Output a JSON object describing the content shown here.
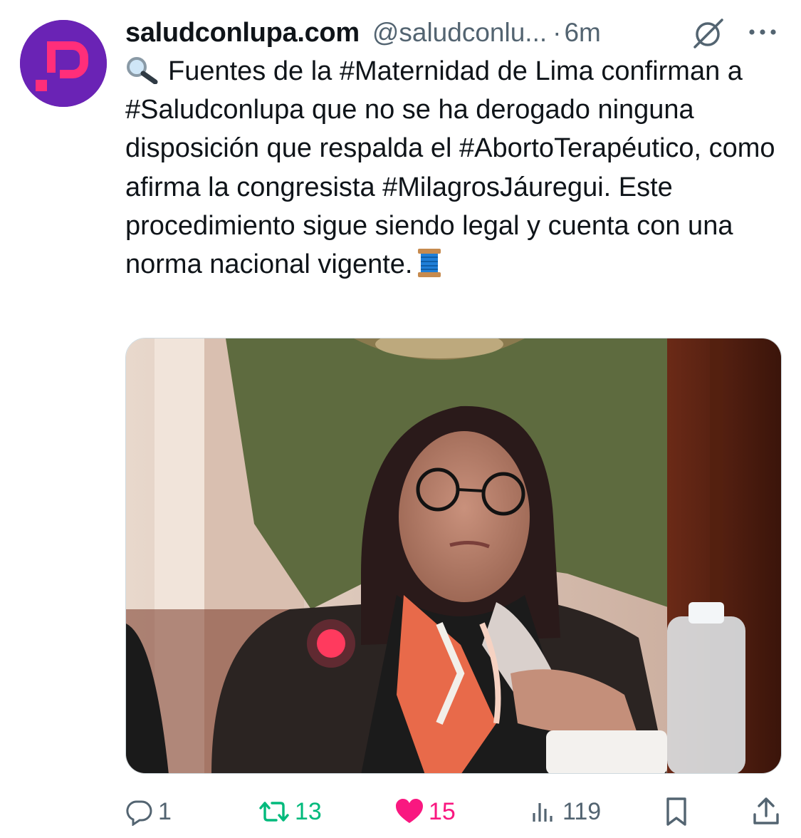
{
  "tweet": {
    "display_name": "saludconlupa.com",
    "handle": "@saludconlu...",
    "separator": "·",
    "time": "6m",
    "text_main": "Fuentes de la #Maternidad de Lima confirman a #Saludconlupa que no se ha derogado ninguna disposición que respalda el #AbortoTerapéutico, como afirma la congresista #MilagrosJáuregui. Este procedimiento sigue siendo legal y cuenta con una norma nacional vigente.",
    "emoji_start": "magnifying-glass-emoji",
    "emoji_end": "thread-spool-emoji"
  },
  "icons": {
    "avatar": "saludconlupa-logo",
    "grok": "grok-icon",
    "more": "more-icon"
  },
  "actions": {
    "replies": "1",
    "retweets": "13",
    "likes": "15",
    "views": "119"
  },
  "colors": {
    "retweet": "#00ba7c",
    "like": "#f91880",
    "muted": "#536471",
    "avatar_bg": "#6a23b5",
    "logo_pink": "#ff2e7a"
  }
}
